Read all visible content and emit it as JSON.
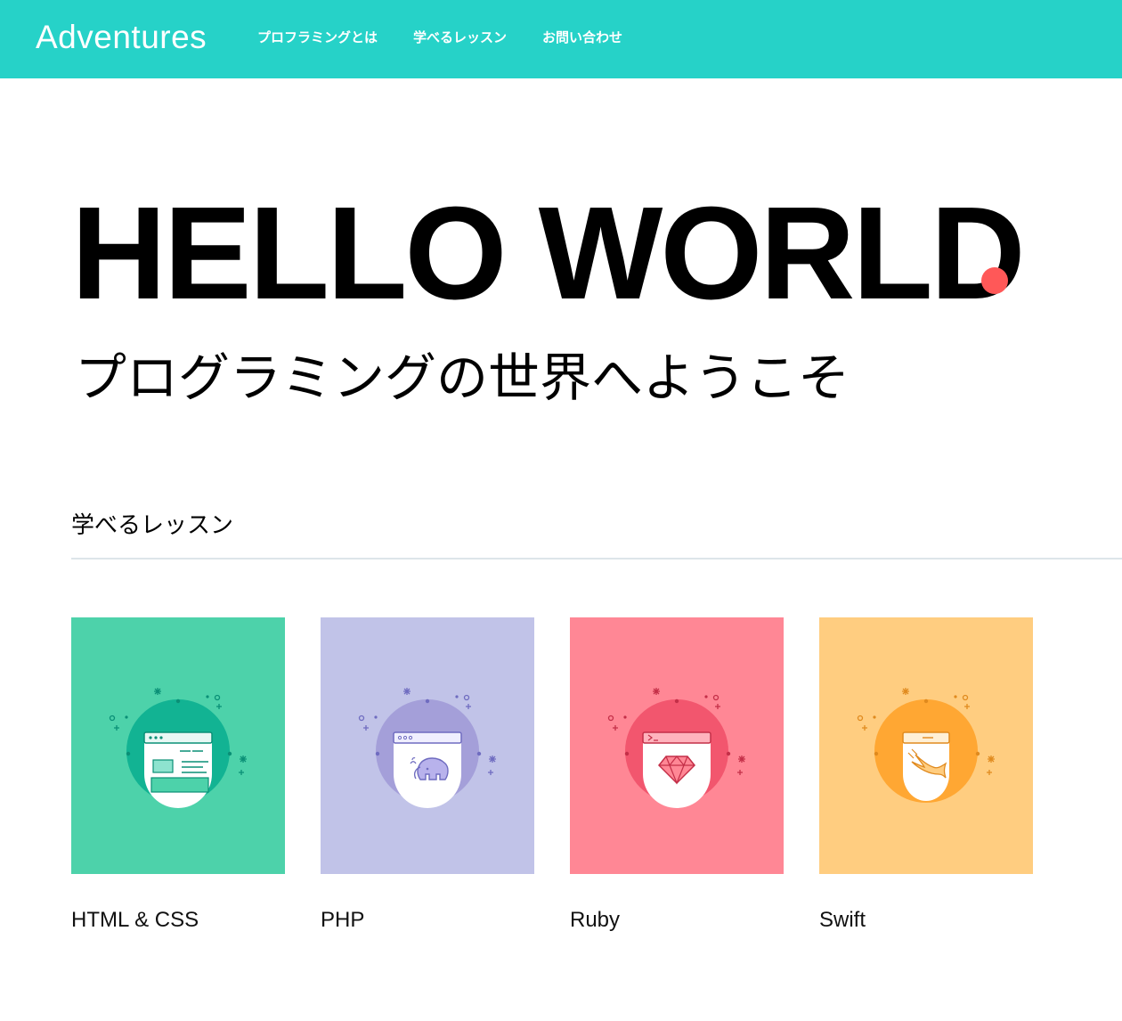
{
  "header": {
    "logo": "Adventures",
    "nav": [
      "プロフラミングとは",
      "学べるレッスン",
      "お問い合わせ"
    ],
    "bg_color": "#26d2c8"
  },
  "hero": {
    "title": "HELLO WORLD",
    "accent_dot_color": "#ff5858",
    "subtitle": "プログラミングの世界へようこそ"
  },
  "lessons": {
    "heading": "学べるレッスン",
    "cards": [
      {
        "label": "HTML & CSS",
        "bg": "#4dd2aa",
        "circle": "#12b393",
        "icon": "browser-window-icon"
      },
      {
        "label": "PHP",
        "bg": "#c1c3e8",
        "circle": "#a49fd9",
        "icon": "elephant-icon"
      },
      {
        "label": "Ruby",
        "bg": "#ff8795",
        "circle": "#f2566e",
        "icon": "ruby-gem-icon"
      },
      {
        "label": "Swift",
        "bg": "#ffcd80",
        "circle": "#ffa733",
        "icon": "swift-bird-icon"
      }
    ]
  }
}
